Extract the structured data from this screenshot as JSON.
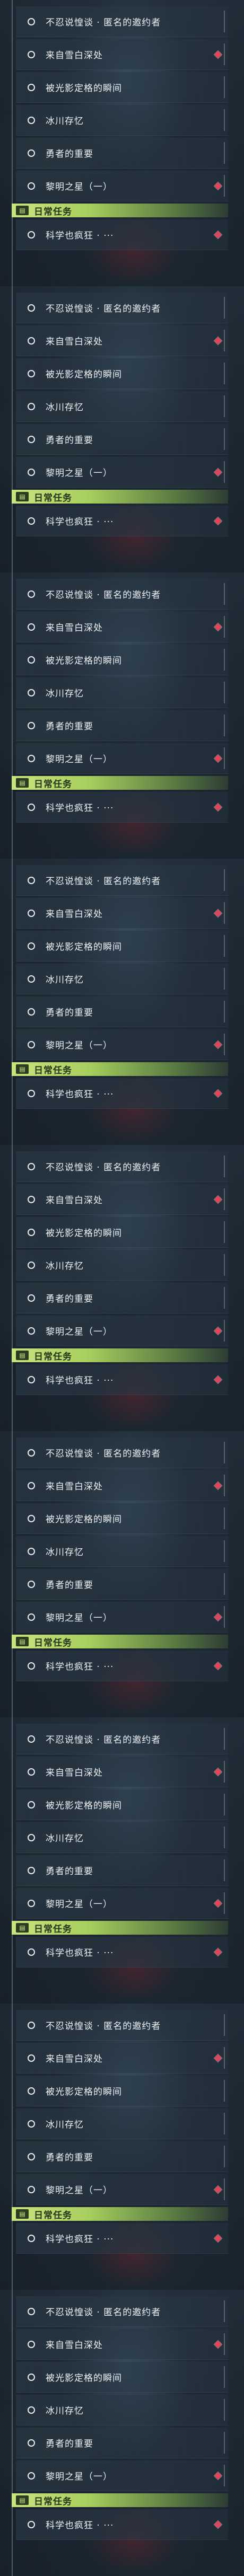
{
  "quests": [
    "不忍说惶谈 · 匿名的邀约者",
    "来自雪白深处",
    "被光影定格的瞬间",
    "冰川存忆",
    "勇者的重要",
    "黎明之星（一）"
  ],
  "daily_section": {
    "title": "日常任务",
    "icon": "book-icon",
    "icon_glyph": "▤"
  },
  "daily_quest": "科学也疯狂 · ···",
  "colors": {
    "section_accent": "#c9e37f",
    "pin": "#e0455a",
    "text": "#f0f3f5"
  }
}
